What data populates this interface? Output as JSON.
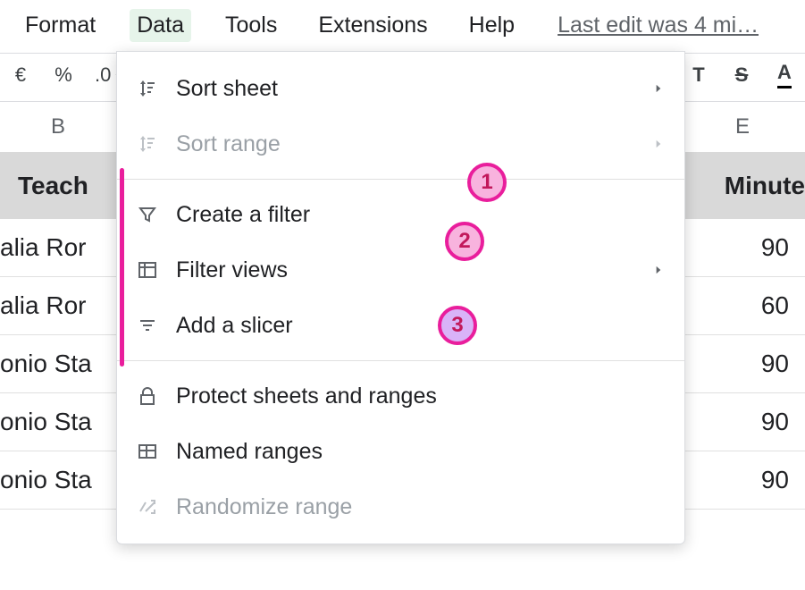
{
  "menubar": {
    "format": "Format",
    "data": "Data",
    "tools": "Tools",
    "extensions": "Extensions",
    "help": "Help",
    "last_edit": "Last edit was 4 mi…"
  },
  "toolbar": {
    "currency": "€",
    "percent": "%",
    "decimal": ".0",
    "strike_label": "S",
    "text_color_label": "A"
  },
  "columns": {
    "B": "B",
    "E": "E"
  },
  "headers": {
    "teacher": "Teach",
    "minutes": "Minute"
  },
  "rows": [
    {
      "teacher": "alia Ror",
      "minutes": "90"
    },
    {
      "teacher": "alia Ror",
      "minutes": "60"
    },
    {
      "teacher": "onio Sta",
      "minutes": "90"
    },
    {
      "teacher": "onio Sta",
      "minutes": "90"
    },
    {
      "teacher": "onio Sta",
      "minutes": "90"
    }
  ],
  "dropdown": {
    "sort_sheet": "Sort sheet",
    "sort_range": "Sort range",
    "create_filter": "Create a filter",
    "filter_views": "Filter views",
    "add_slicer": "Add a slicer",
    "protect": "Protect sheets and ranges",
    "named_ranges": "Named ranges",
    "randomize": "Randomize range"
  },
  "annotations": {
    "b1": "1",
    "b2": "2",
    "b3": "3"
  }
}
